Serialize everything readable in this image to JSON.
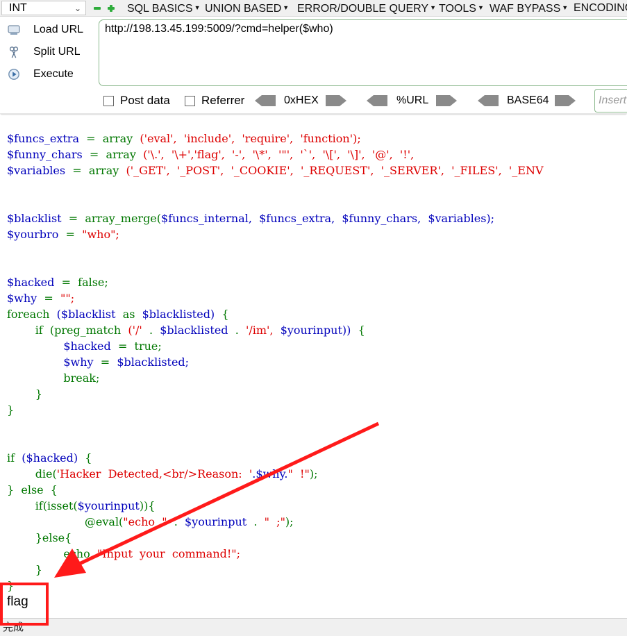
{
  "toolbar": {
    "select_value": "INT",
    "menus": [
      "SQL BASICS",
      "UNION BASED",
      "ERROR/DOUBLE QUERY",
      "TOOLS",
      "WAF BYPASS",
      "ENCODING"
    ]
  },
  "actions": {
    "load_url": "Load URL",
    "split_url": "Split URL",
    "execute": "Execute"
  },
  "url": "http://198.13.45.199:5009/?cmd=helper($who)",
  "options": {
    "post_data": "Post data",
    "referrer": "Referrer",
    "hex": "0xHEX",
    "url": "%URL",
    "base64": "BASE64",
    "insert_placeholder": "Insert"
  },
  "code": {
    "l1": [
      "$funcs_extra",
      "=",
      "array",
      "('eval',",
      "'include',",
      "'require',",
      "'function');"
    ],
    "l2": [
      "$funny_chars",
      "=",
      "array",
      "('\\.',",
      "'\\+','flag',",
      "'-',",
      "'\\*',",
      "'\"',",
      "'`',",
      "'\\[',",
      "'\\]',",
      "'@',",
      "'!',"
    ],
    "l3": [
      "$variables",
      "=",
      "array",
      "('_GET',",
      "'_POST',",
      "'_COOKIE',",
      "'_REQUEST',",
      "'_SERVER',",
      "'_FILES',",
      "'_ENV"
    ],
    "l5": [
      "$blacklist",
      "=",
      "array_merge(",
      "$funcs_internal,",
      "$funcs_extra,",
      "$funny_chars,",
      "$variables);"
    ],
    "l6": [
      "$yourbro",
      "=",
      "\"who\";"
    ],
    "l8": [
      "$hacked",
      "=",
      "false;"
    ],
    "l9": [
      "$why",
      "=",
      "\"\";"
    ],
    "l10": [
      "foreach",
      "($blacklist",
      "as",
      "$blacklisted)",
      "{"
    ],
    "l11": [
      "if",
      "(preg_match",
      "('/'",
      ".",
      "$blacklisted",
      ".",
      "'/im',",
      "$yourinput))",
      "{"
    ],
    "l12": [
      "$hacked",
      "=",
      "true;"
    ],
    "l13": [
      "$why",
      "=",
      "$blacklisted;"
    ],
    "l14": [
      "break;"
    ],
    "l15": [
      "}"
    ],
    "l16": [
      "}"
    ],
    "l18": [
      "if",
      "($hacked)",
      "{"
    ],
    "l19": [
      "die(",
      "'Hacker  Detected,<br/>Reason:  '",
      ".$why.",
      "\"  !\"",
      ");"
    ],
    "l20": [
      "}",
      "else",
      "{"
    ],
    "l21": [
      "if(isset(",
      "$yourinput",
      ")){"
    ],
    "l22": [
      "@eval(",
      "\"echo  \"",
      ".",
      "$yourinput",
      ".",
      "\"  ;\"",
      ");"
    ],
    "l23": [
      "}else{"
    ],
    "l24": [
      "echo",
      "\"Input  your  command!\";"
    ],
    "l25": [
      "}"
    ],
    "l26": [
      "}"
    ]
  },
  "output": "flag",
  "status": "完成",
  "colors": {
    "variable": "#0000bb",
    "keyword": "#007700",
    "string": "#dd0000",
    "annotation": "#ff1a1a"
  }
}
